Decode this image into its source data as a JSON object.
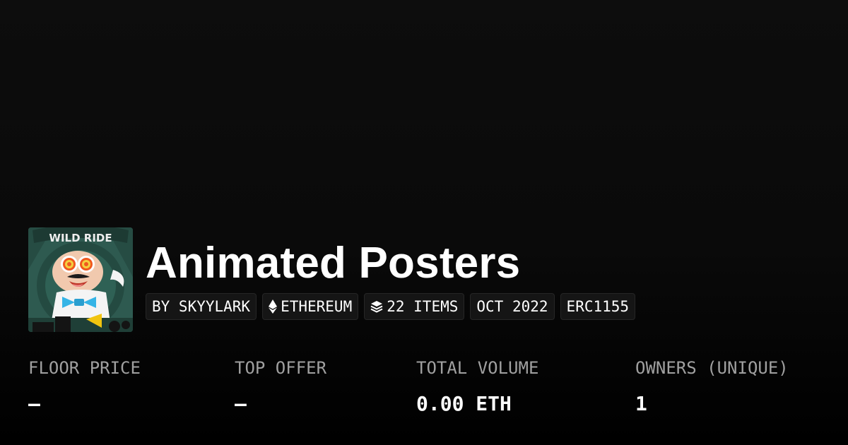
{
  "collection": {
    "title": "Animated Posters",
    "avatar": {
      "icon": "poster-thumbnail-icon",
      "caption": "WILD RIDE",
      "colors": {
        "background": "#2e5a50",
        "face": "#f1c9ae",
        "eyes": "#f0591f",
        "bowtie": "#35b4e6"
      }
    }
  },
  "chips": {
    "creator": "BY SKYYLARK",
    "chain": {
      "icon": "ethereum-icon",
      "label": "ETHEREUM"
    },
    "items": {
      "icon": "layers-icon",
      "label": "22 ITEMS"
    },
    "date": "OCT 2022",
    "standard": "ERC1155"
  },
  "stats": {
    "floor_price": {
      "label": "FLOOR PRICE",
      "value": "—"
    },
    "top_offer": {
      "label": "TOP OFFER",
      "value": "—"
    },
    "total_volume": {
      "label": "TOTAL VOLUME",
      "value": "0.00 ETH"
    },
    "owners": {
      "label": "OWNERS (UNIQUE)",
      "value": "1"
    }
  },
  "colors": {
    "background": "#0a0a0a",
    "text_primary": "#ffffff",
    "text_muted": "#a0a0a0",
    "chip_background": "#151515",
    "chip_border": "#262626"
  }
}
